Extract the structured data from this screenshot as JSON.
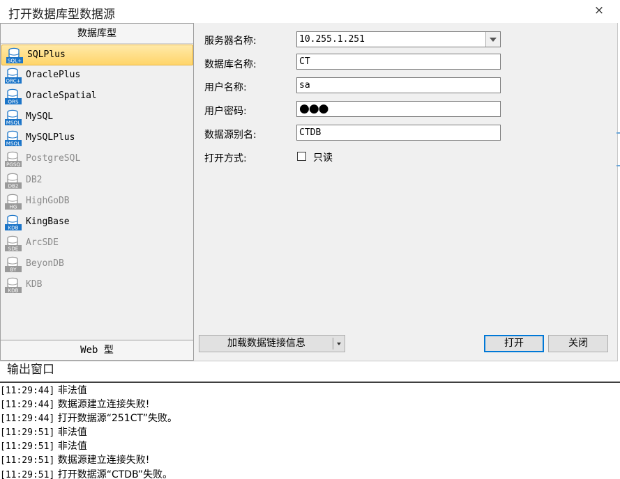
{
  "dialog": {
    "title": "打开数据库型数据源",
    "close_icon": "×",
    "left_panel": {
      "header": "数据库型",
      "footer": "Web 型",
      "items": [
        {
          "label": "SQLPlus",
          "icon": "SQL+",
          "icon_color": "#1c75c8",
          "enabled": true,
          "selected": true
        },
        {
          "label": "OraclePlus",
          "icon": "ORC+",
          "icon_color": "#1c75c8",
          "enabled": true,
          "selected": false
        },
        {
          "label": "OracleSpatial",
          "icon": "ORS",
          "icon_color": "#1c75c8",
          "enabled": true,
          "selected": false
        },
        {
          "label": "MySQL",
          "icon": "MSQL",
          "icon_color": "#1c75c8",
          "enabled": true,
          "selected": false
        },
        {
          "label": "MySQLPlus",
          "icon": "MSQL",
          "icon_color": "#1c75c8",
          "enabled": true,
          "selected": false
        },
        {
          "label": "PostgreSQL",
          "icon": "PGSQ",
          "icon_color": "#9a9a9a",
          "enabled": false,
          "selected": false
        },
        {
          "label": "DB2",
          "icon": "DB2",
          "icon_color": "#9a9a9a",
          "enabled": false,
          "selected": false
        },
        {
          "label": "HighGoDB",
          "icon": "HG",
          "icon_color": "#9a9a9a",
          "enabled": false,
          "selected": false
        },
        {
          "label": "KingBase",
          "icon": "KDB",
          "icon_color": "#1c75c8",
          "enabled": true,
          "selected": false
        },
        {
          "label": "ArcSDE",
          "icon": "SDE",
          "icon_color": "#9a9a9a",
          "enabled": false,
          "selected": false
        },
        {
          "label": "BeyonDB",
          "icon": "BY",
          "icon_color": "#9a9a9a",
          "enabled": false,
          "selected": false
        },
        {
          "label": "KDB",
          "icon": "KDB",
          "icon_color": "#9a9a9a",
          "enabled": false,
          "selected": false
        }
      ]
    },
    "form": {
      "server_label": "服务器名称:",
      "server_value": "10.255.1.251",
      "database_label": "数据库名称:",
      "database_value": "CT",
      "user_label": "用户名称:",
      "user_value": "sa",
      "password_label": "用户密码:",
      "password_value": "●●●",
      "alias_label": "数据源别名:",
      "alias_value": "CTDB",
      "open_mode_label": "打开方式:",
      "readonly_label": "只读"
    },
    "buttons": {
      "load_label": "加载数据链接信息",
      "open_label": "打开",
      "close_label": "关闭"
    }
  },
  "output": {
    "title": "输出窗口",
    "lines": [
      {
        "time": "[11:29:44]",
        "text": " 非法值"
      },
      {
        "time": "[11:29:44]",
        "text": " 数据源建立连接失败!"
      },
      {
        "time": "[11:29:44]",
        "text": " 打开数据源“251CT”失败。"
      },
      {
        "time": "[11:29:51]",
        "text": " 非法值"
      },
      {
        "time": "[11:29:51]",
        "text": " 非法值"
      },
      {
        "time": "[11:29:51]",
        "text": " 数据源建立连接失败!"
      },
      {
        "time": "[11:29:51]",
        "text": " 打开数据源“CTDB”失败。"
      }
    ]
  }
}
